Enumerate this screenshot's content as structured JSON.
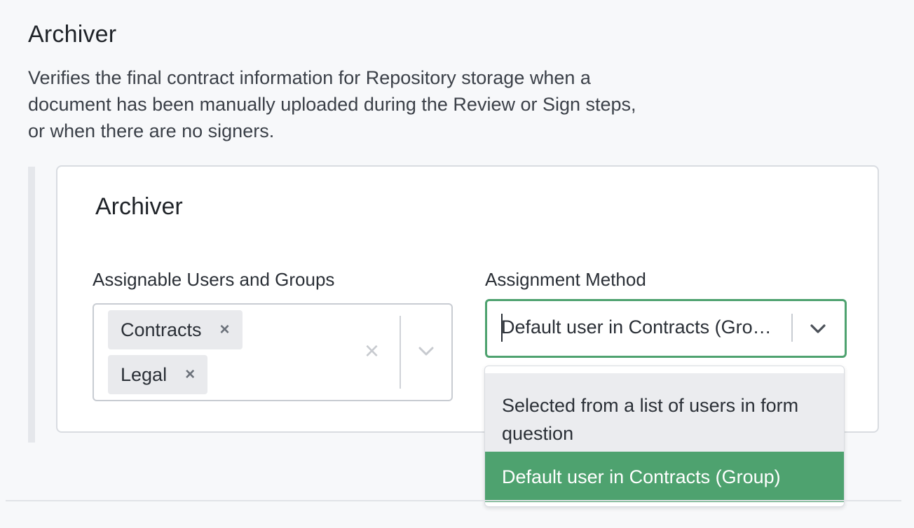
{
  "section": {
    "title": "Archiver",
    "description": "Verifies the final contract information for Repository storage when a document has been manually uploaded during the Review or Sign steps, or when there are no signers."
  },
  "card": {
    "title": "Archiver",
    "users_field": {
      "label": "Assignable Users and Groups",
      "tags": [
        {
          "label": "Contracts",
          "remove_icon": "×"
        },
        {
          "label": "Legal",
          "remove_icon": "×"
        }
      ],
      "clear_icon": "×",
      "toggle_icon": "chevron-down-icon"
    },
    "method_field": {
      "label": "Assignment Method",
      "value": "Default user in Contracts (Gro…",
      "toggle_icon": "chevron-down-icon",
      "options": [
        {
          "label": "Selected from a list of users in form question"
        },
        {
          "label": "Default user in Contracts (Group)",
          "selected": true
        }
      ]
    }
  },
  "colors": {
    "accent_green": "#4ea26f",
    "page_bg": "#f7f8fa",
    "tag_bg": "#e9eaed",
    "option_hover_bg": "#ebecef"
  }
}
